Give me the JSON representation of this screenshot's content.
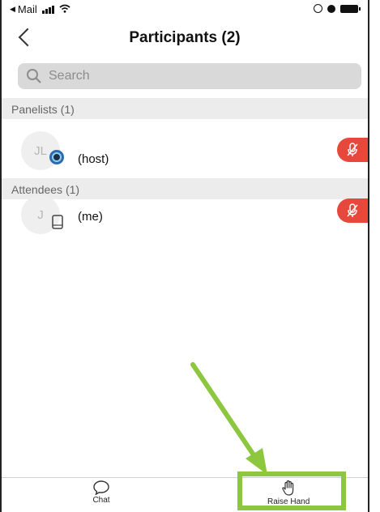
{
  "status_bar": {
    "back_app": "Mail"
  },
  "nav": {
    "title": "Participants (2)"
  },
  "search": {
    "placeholder": "Search"
  },
  "sections": [
    {
      "header": "Panelists (1)",
      "participants": [
        {
          "initials": "JL",
          "name": "(host)",
          "device": "desktop-icon",
          "muted": true
        }
      ]
    },
    {
      "header": "Attendees (1)",
      "participants": [
        {
          "initials": "J",
          "name": "(me)",
          "device": "phone-icon",
          "muted": true
        }
      ]
    }
  ],
  "bottom_bar": {
    "chat_label": "Chat",
    "raise_hand_label": "Raise Hand"
  },
  "colors": {
    "mute": "#e8473b",
    "highlight": "#8dc63f",
    "section_bg": "#ececec"
  }
}
